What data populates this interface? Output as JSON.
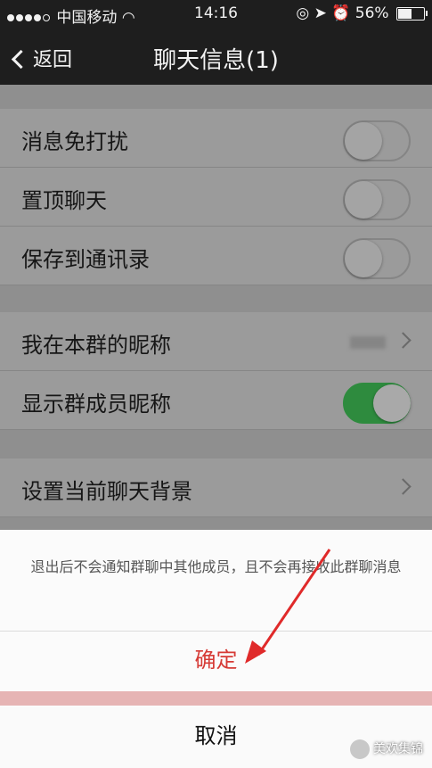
{
  "status_bar": {
    "carrier": "中国移动",
    "time": "14:16",
    "battery": "56%",
    "battery_level": 0.56,
    "signal_bars": 5,
    "icons": [
      "wifi-icon",
      "lock-rotation-icon",
      "location-icon",
      "alarm-icon",
      "battery-icon"
    ]
  },
  "nav": {
    "back_label": "返回",
    "title": "聊天信息(1)"
  },
  "settings": {
    "mute": {
      "label": "消息免打扰",
      "on": false
    },
    "pin": {
      "label": "置顶聊天",
      "on": false
    },
    "save_contacts": {
      "label": "保存到通讯录",
      "on": false
    },
    "group_nickname": {
      "label": "我在本群的昵称"
    },
    "show_member_names": {
      "label": "显示群成员昵称",
      "on": true
    },
    "chat_background": {
      "label": "设置当前聊天背景"
    }
  },
  "sheet": {
    "message": "退出后不会通知群聊中其他成员，且不会再接收此群聊消息",
    "confirm_label": "确定",
    "cancel_label": "取消"
  },
  "watermark": {
    "text": "美欢集锦"
  },
  "colors": {
    "toggle_on": "#2e8b3e",
    "confirm_red": "#d63b36",
    "arrow_red": "#e02a2a"
  }
}
